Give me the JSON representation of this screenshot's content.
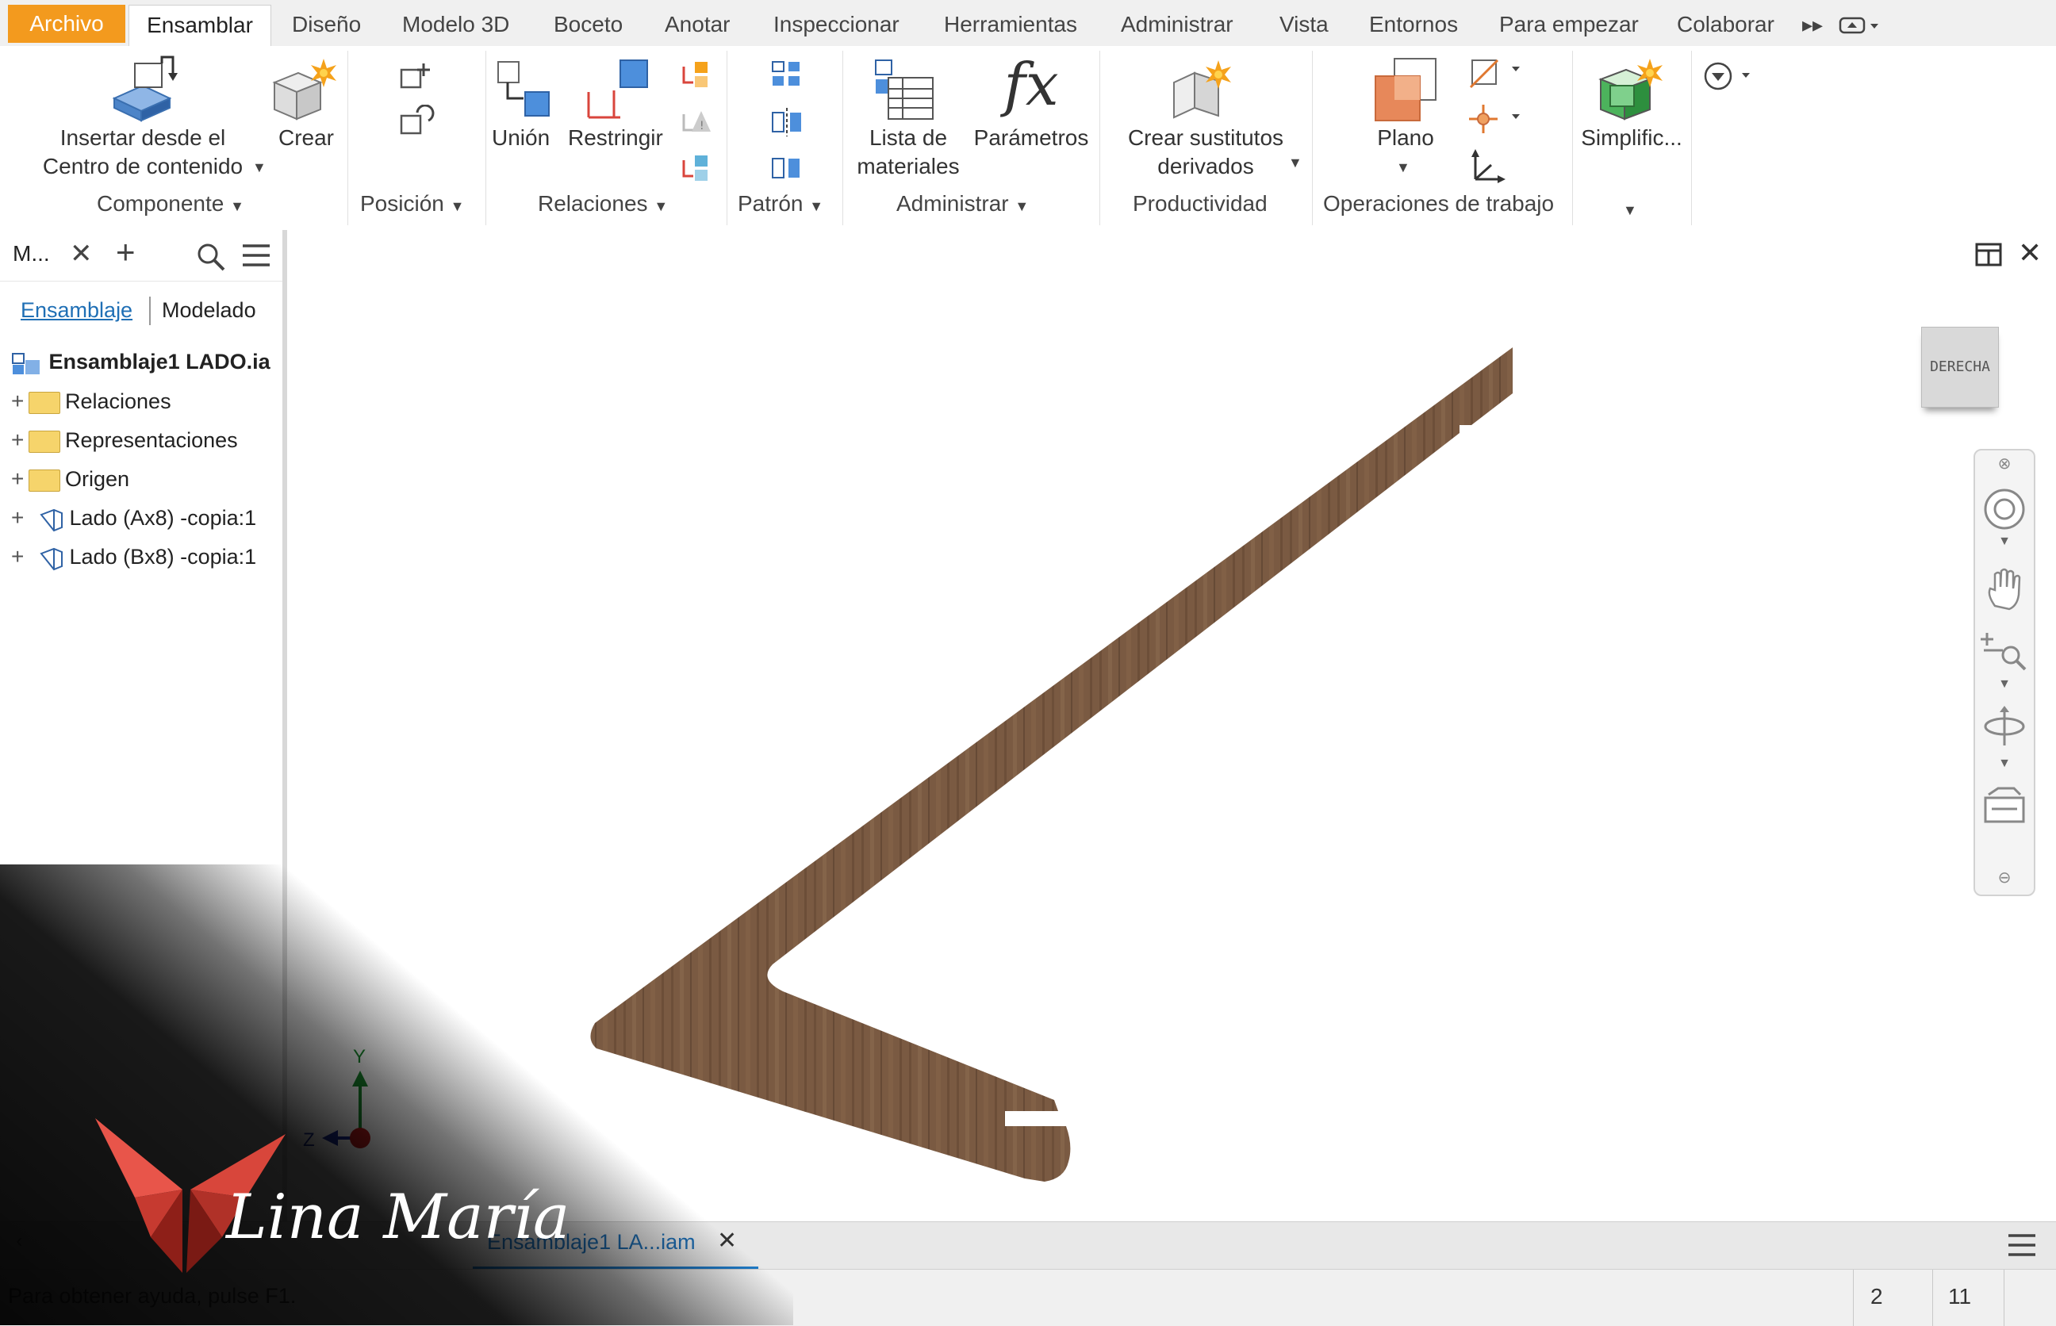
{
  "menu": {
    "file": "Archivo",
    "active": "Ensamblar",
    "tabs": [
      "Diseño",
      "Modelo 3D",
      "Boceto",
      "Anotar",
      "Inspeccionar",
      "Herramientas",
      "Administrar",
      "Vista",
      "Entornos",
      "Para empezar",
      "Colaborar"
    ]
  },
  "ribbon": {
    "place_l1": "Insertar desde el",
    "place_l2": "Centro de contenido",
    "create": "Crear",
    "join": "Unión",
    "constrain": "Restringir",
    "bom_l1": "Lista de",
    "bom_l2": "materiales",
    "params": "Parámetros",
    "params_symbol": "fx",
    "derived_l1": "Crear sustitutos",
    "derived_l2": "derivados",
    "plane": "Plano",
    "simplify": "Simplific...",
    "groups": {
      "component": "Componente",
      "position": "Posición",
      "relations": "Relaciones",
      "pattern": "Patrón",
      "manage": "Administrar",
      "productivity": "Productividad",
      "workfeatures": "Operaciones de trabajo"
    }
  },
  "browser": {
    "title": "M...",
    "tab_assembly": "Ensamblaje",
    "tab_modeling": "Modelado",
    "root": "Ensamblaje1 LADO.ia",
    "items": [
      "Relaciones",
      "Representaciones",
      "Origen",
      "Lado (Ax8) -copia:1",
      "Lado (Bx8) -copia:1"
    ]
  },
  "viewcube": {
    "face": "DERECHA"
  },
  "triad": {
    "y": "Y",
    "z": "Z"
  },
  "doc_tab": "Ensamblaje1 LA...iam",
  "watermark": "Lina María",
  "status": {
    "help": "Para obtener ayuda, pulse F1.",
    "n1": "2",
    "n2": "11"
  },
  "colors": {
    "accent": "#f39a1e",
    "wood": "#7a5a42",
    "link": "#1f6fb5"
  }
}
